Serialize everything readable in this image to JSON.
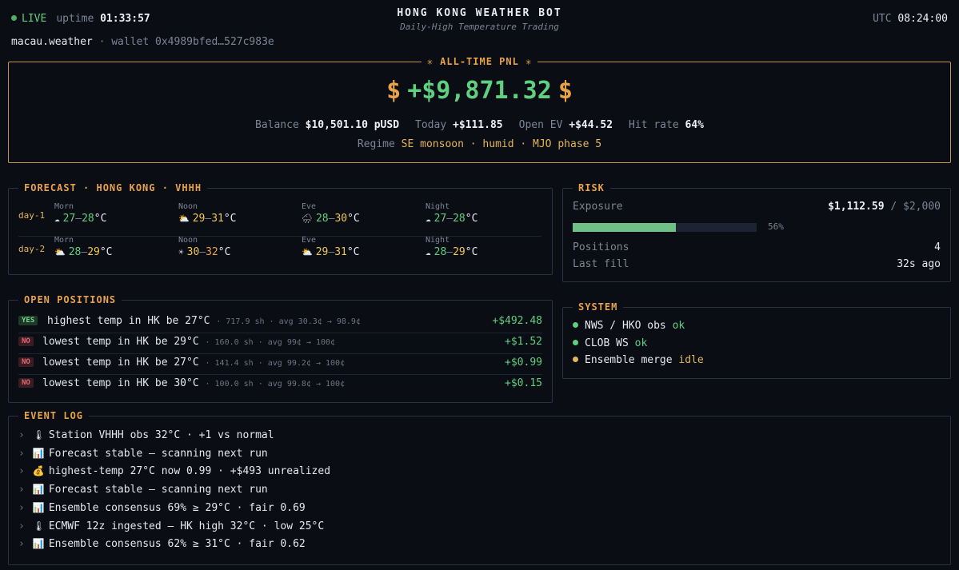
{
  "header": {
    "live_label": "LIVE",
    "uptime_label": "uptime",
    "uptime": "01:33:57",
    "title": "HONG KONG WEATHER BOT",
    "subtitle": "Daily-High Temperature Trading",
    "utc_label": "UTC",
    "utc_time": "08:24:00",
    "account_name": "macau.weather",
    "wallet": "wallet 0x4989bfed…527c983e"
  },
  "pnl": {
    "title": "✳ ALL-TIME PNL ✳",
    "currency_symbol": "$",
    "value": "+$9,871.32",
    "balance_label": "Balance",
    "balance": "$10,501.10 pUSD",
    "today_label": "Today",
    "today": "+$111.85",
    "open_ev_label": "Open EV",
    "open_ev": "+$44.52",
    "hit_rate_label": "Hit rate",
    "hit_rate": "64%",
    "regime_label": "Regime",
    "regime": "SE monsoon · humid · MJO phase 5"
  },
  "forecast": {
    "title": "FORECAST · HONG KONG · VHHH",
    "days": [
      {
        "label": "day-1",
        "slots": [
          {
            "segment": "Morn",
            "icon": "cloud-icon",
            "glyph": "☁",
            "low": "27",
            "high": "28",
            "unit": "°C"
          },
          {
            "segment": "Noon",
            "icon": "partly-sunny-icon",
            "glyph": "⛅",
            "low": "29",
            "high": "31",
            "unit": "°C"
          },
          {
            "segment": "Eve",
            "icon": "rain-cloud-icon",
            "glyph": "🌧",
            "low": "28",
            "high": "30",
            "unit": "°C"
          },
          {
            "segment": "Night",
            "icon": "cloud-icon",
            "glyph": "☁",
            "low": "27",
            "high": "28",
            "unit": "°C"
          }
        ]
      },
      {
        "label": "day-2",
        "slots": [
          {
            "segment": "Morn",
            "icon": "partly-sunny-icon",
            "glyph": "⛅",
            "low": "28",
            "high": "29",
            "unit": "°C"
          },
          {
            "segment": "Noon",
            "icon": "sun-icon",
            "glyph": "☀",
            "low": "30",
            "high": "32",
            "unit": "°C"
          },
          {
            "segment": "Eve",
            "icon": "partly-sunny-icon",
            "glyph": "⛅",
            "low": "29",
            "high": "31",
            "unit": "°C"
          },
          {
            "segment": "Night",
            "icon": "cloud-icon",
            "glyph": "☁",
            "low": "28",
            "high": "29",
            "unit": "°C"
          }
        ]
      }
    ],
    "colors": {
      "low_green": "#5fcf80",
      "mid_yellow": "#efc755",
      "high_orange": "#e8a24a"
    }
  },
  "risk": {
    "title": "RISK",
    "exposure_label": "Exposure",
    "exposure": "$1,112.59",
    "separator": "/",
    "limit": "$2,000",
    "utilization_percent": 56,
    "utilization_label": "56%",
    "positions_label": "Positions",
    "positions": "4",
    "last_fill_label": "Last fill",
    "last_fill": "32s ago"
  },
  "positions": {
    "title": "OPEN POSITIONS",
    "rows": [
      {
        "side": "YES",
        "question": "highest temp in HK be 27°C",
        "meta": "· 717.9 sh · avg 30.3¢ → 98.9¢",
        "pnl": "+$492.48"
      },
      {
        "side": "NO",
        "question": "lowest temp in HK be 29°C",
        "meta": "· 160.0 sh · avg 99¢ → 100¢",
        "pnl": "+$1.52"
      },
      {
        "side": "NO",
        "question": "lowest temp in HK be 27°C",
        "meta": "· 141.4 sh · avg 99.2¢ → 100¢",
        "pnl": "+$0.99"
      },
      {
        "side": "NO",
        "question": "lowest temp in HK be 30°C",
        "meta": "· 100.0 sh · avg 99.8¢ → 100¢",
        "pnl": "+$0.15"
      }
    ]
  },
  "system": {
    "title": "SYSTEM",
    "rows": [
      {
        "name": "NWS / HKO obs",
        "status": "ok",
        "color": "#5fcf80"
      },
      {
        "name": "CLOB WS",
        "status": "ok",
        "color": "#5fcf80"
      },
      {
        "name": "Ensemble merge",
        "status": "idle",
        "color": "#e2b659"
      }
    ]
  },
  "event_log": {
    "title": "EVENT LOG",
    "chevron": "›",
    "rows": [
      {
        "icon": "thermometer-icon",
        "glyph": "🌡",
        "text": "Station VHHH obs 32°C · +1 vs normal"
      },
      {
        "icon": "chart-icon",
        "glyph": "📊",
        "text": "Forecast stable — scanning next run"
      },
      {
        "icon": "money-bag-icon",
        "glyph": "💰",
        "text": "highest-temp 27°C now 0.99 · +$493 unrealized"
      },
      {
        "icon": "chart-icon",
        "glyph": "📊",
        "text": "Forecast stable — scanning next run"
      },
      {
        "icon": "chart-icon",
        "glyph": "📊",
        "text": "Ensemble consensus 69% ≥ 29°C · fair 0.69"
      },
      {
        "icon": "thermometer-icon",
        "glyph": "🌡",
        "text": "ECMWF 12z ingested — HK high 32°C · low 25°C"
      },
      {
        "icon": "chart-icon",
        "glyph": "📊",
        "text": "Ensemble consensus 62% ≥ 31°C · fair 0.62"
      }
    ]
  }
}
